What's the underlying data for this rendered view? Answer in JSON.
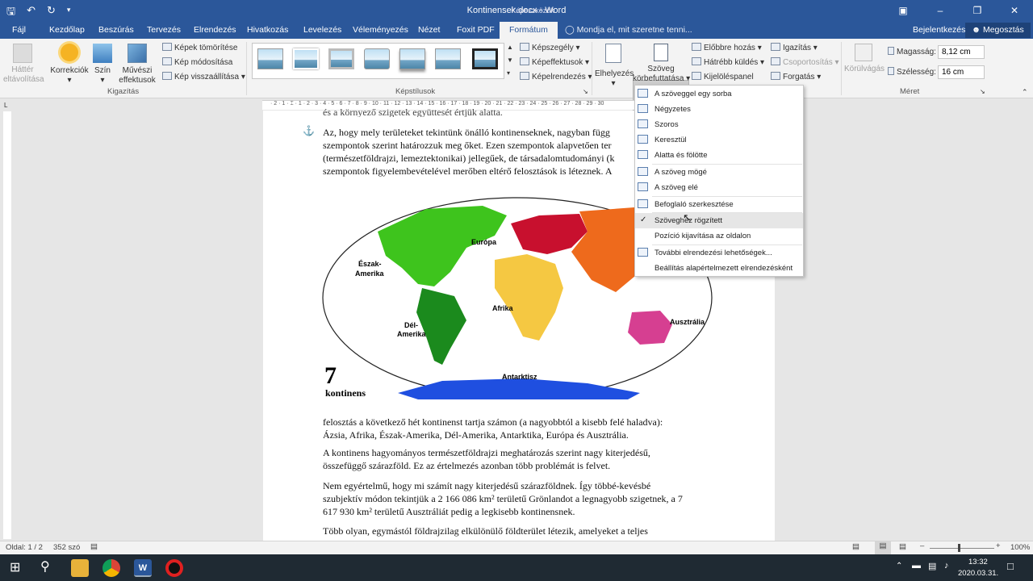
{
  "titlebar": {
    "title": "Kontinensek.docx  -  Word",
    "context_tab": "Képeszközök"
  },
  "tabs": [
    "Fájl",
    "Kezdőlap",
    "Beszúrás",
    "Tervezés",
    "Elrendezés",
    "Hivatkozás",
    "Levelezés",
    "Véleményezés",
    "Nézet",
    "Foxit PDF",
    "Formátum"
  ],
  "tellme": "Mondja el, mit szeretne tenni...",
  "signin": "Bejelentkezés",
  "share": "Megosztás",
  "ribbon": {
    "bg_remove": [
      "Háttér",
      "eltávolítása"
    ],
    "corrections": "Korrekciók",
    "color": "Szín",
    "artistic": [
      "Művészi",
      "effektusok"
    ],
    "compress": "Képek tömörítése",
    "change": "Kép módosítása",
    "reset": "Kép visszaállítása",
    "group_adjust": "Kigazítás",
    "group_styles": "Képstílusok",
    "border": "Képszegély",
    "effects": "Képeffektusok",
    "layout": "Képelrendezés",
    "position": "Elhelyezés",
    "wrap": [
      "Szöveg",
      "körbefuttatása"
    ],
    "forward": "Előbbre hozás",
    "backward": "Hátrébb küldés",
    "pane": "Kijelöléspanel",
    "align": "Igazítás",
    "group": "Csoportosítás",
    "rotate": "Forgatás",
    "crop": "Körülvágás",
    "height_label": "Magasság:",
    "height_val": "8,12 cm",
    "width_label": "Szélesség:",
    "width_val": "16 cm",
    "group_size": "Méret"
  },
  "wrap_menu": [
    {
      "label": "A szöveggel egy sorba",
      "check": false
    },
    {
      "label": "Négyzetes",
      "check": false
    },
    {
      "label": "Szoros",
      "check": false
    },
    {
      "label": "Keresztül",
      "check": false
    },
    {
      "label": "Alatta és fölötte",
      "check": false
    },
    {
      "label": "A szöveg mögé",
      "check": false
    },
    {
      "label": "A szöveg elé",
      "check": false
    },
    {
      "label": "Befoglaló szerkesztése",
      "check": false
    },
    {
      "label": "Szöveghez rögzített",
      "check": true
    },
    {
      "label": "Pozíció kijavítása az oldalon",
      "check": false
    },
    {
      "label": "További elrendezési lehetőségek...",
      "check": false
    },
    {
      "label": "Beállítás alapértelmezett elrendezésként",
      "check": false
    }
  ],
  "doc": {
    "top_fragment": "és a környező szigetek együttesét értjük alatta.",
    "p1": [
      "Az, hogy mely területeket tekintünk önálló kontinenseknek, nagyban függ",
      "szempontok szerint határozzuk meg őket. Ezen szempontok alapvetően ter",
      "(természetföldrajzi, lemeztektonikai) jellegűek, de társadalomtudományi (k",
      "szempontok figyelembevételével merőben eltérő felosztások is léteznek. A"
    ],
    "p2": [
      "felosztás a következő hét kontinenst tartja számon (a nagyobbtól a kisebb felé haladva):",
      "Ázsia, Afrika, Észak-Amerika, Dél-Amerika, Antarktika, Európa és Ausztrália."
    ],
    "p3": [
      "A kontinens hagyományos természetföldrajzi meghatározás szerint nagy kiterjedésű,",
      "összefüggő szárazföld. Ez az értelmezés azonban több problémát is felvet."
    ],
    "p4": [
      "Nem egyértelmű, hogy mi számít nagy kiterjedésű szárazföldnek. Így többé-kevésbé",
      "szubjektív módon tekintjük a 2 166 086 km² területű Grönlandot a legnagyobb szigetnek, a 7",
      "617 930 km² területű Ausztráliát pedig a legkisebb kontinensnek."
    ],
    "p5": "Több olyan, egymástól földrajzilag elkülönülő földterület létezik, amelyeket a teljes"
  },
  "map": {
    "number": "7",
    "word": "kontinens",
    "labels": [
      "Európa",
      "Észak-",
      "Amerika",
      "Afrika",
      "Dél-",
      "Amerika",
      "Ausztrália",
      "Antarktisz"
    ]
  },
  "status": {
    "page": "Oldal: 1 / 2",
    "words": "352 szó",
    "zoom": "100%"
  },
  "clock": {
    "time": "13:32",
    "date": "2020.03.31."
  },
  "colors": {
    "word_blue": "#2b579a",
    "na": "#3ec41d",
    "sa": "#1b8a1d",
    "africa": "#f5c842",
    "europe": "#c8102e",
    "asia": "#ee6a1c",
    "australia": "#d63f91",
    "antarctica": "#1f4fe0"
  }
}
